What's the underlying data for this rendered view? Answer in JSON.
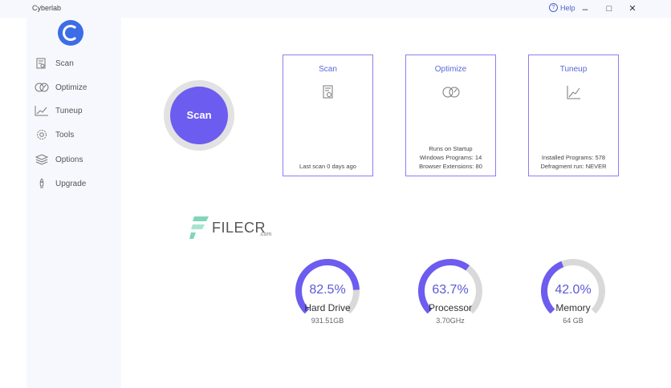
{
  "app": {
    "title": "Cyberlab"
  },
  "window": {
    "help_label": "Help",
    "minimize": "–",
    "maximize": "□",
    "close": "✕"
  },
  "sidebar": {
    "items": [
      {
        "label": "Scan",
        "icon": "scan-icon"
      },
      {
        "label": "Optimize",
        "icon": "optimize-icon"
      },
      {
        "label": "Tuneup",
        "icon": "tuneup-icon"
      },
      {
        "label": "Tools",
        "icon": "gear-icon"
      },
      {
        "label": "Options",
        "icon": "layers-icon"
      },
      {
        "label": "Upgrade",
        "icon": "rocket-icon"
      }
    ]
  },
  "main": {
    "scan_button": "Scan",
    "cards": [
      {
        "title": "Scan",
        "icon": "scan-icon",
        "lines": [
          "Last scan 0 days ago"
        ]
      },
      {
        "title": "Optimize",
        "icon": "optimize-icon",
        "lines": [
          "Runs on Startup",
          "Windows Programs: 14",
          "Browser Extensions: 80"
        ]
      },
      {
        "title": "Tuneup",
        "icon": "tuneup-icon",
        "lines": [
          "Installed Programs: 578",
          "Defragment run: NEVER"
        ]
      }
    ],
    "gauges": [
      {
        "percent": "82.5%",
        "value": 0.825,
        "label": "Hard Drive",
        "sub": "931.51GB"
      },
      {
        "percent": "63.7%",
        "value": 0.637,
        "label": "Processor",
        "sub": "3.70GHz"
      },
      {
        "percent": "42.0%",
        "value": 0.42,
        "label": "Memory",
        "sub": "64 GB"
      }
    ]
  },
  "watermark": {
    "text": "FILECR",
    "suffix": ".com"
  },
  "colors": {
    "accent": "#6c5cf0",
    "card_border": "#8c7ff0",
    "gauge_track": "#d9d9d9"
  }
}
